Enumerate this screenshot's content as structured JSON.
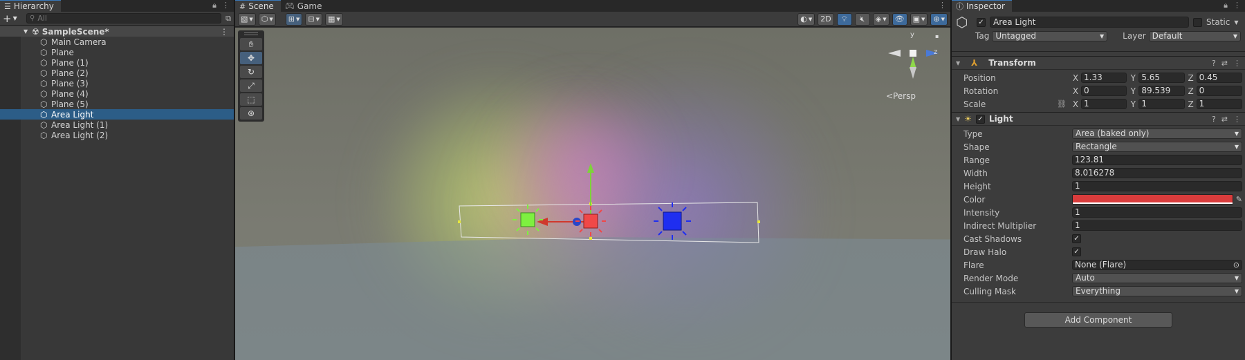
{
  "hierarchy": {
    "tab_label": "Hierarchy",
    "search_placeholder": "All",
    "scene_name": "SampleScene*",
    "items": [
      {
        "label": "Main Camera"
      },
      {
        "label": "Plane"
      },
      {
        "label": "Plane (1)"
      },
      {
        "label": "Plane (2)"
      },
      {
        "label": "Plane (3)"
      },
      {
        "label": "Plane (4)"
      },
      {
        "label": "Plane (5)"
      },
      {
        "label": "Area Light",
        "selected": true
      },
      {
        "label": "Area Light (1)"
      },
      {
        "label": "Area Light (2)"
      }
    ]
  },
  "scene": {
    "tabs": [
      {
        "label": "Scene"
      },
      {
        "label": "Game"
      }
    ],
    "toolbar_2d": "2D",
    "persp_label": "<Persp",
    "gizmo_axes": {
      "y": "y",
      "z": "z"
    }
  },
  "inspector": {
    "tab_label": "Inspector",
    "object_name": "Area Light",
    "static_label": "Static",
    "tag_label": "Tag",
    "tag_value": "Untagged",
    "layer_label": "Layer",
    "layer_value": "Default",
    "transform": {
      "title": "Transform",
      "position": {
        "label": "Position",
        "x": "1.33",
        "y": "5.65",
        "z": "0.45"
      },
      "rotation": {
        "label": "Rotation",
        "x": "0",
        "y": "89.539",
        "z": "0"
      },
      "scale": {
        "label": "Scale",
        "x": "1",
        "y": "1",
        "z": "1"
      }
    },
    "light": {
      "title": "Light",
      "type": {
        "label": "Type",
        "value": "Area (baked only)"
      },
      "shape": {
        "label": "Shape",
        "value": "Rectangle"
      },
      "range": {
        "label": "Range",
        "value": "123.81"
      },
      "width": {
        "label": "Width",
        "value": "8.016278"
      },
      "height": {
        "label": "Height",
        "value": "1"
      },
      "color": {
        "label": "Color",
        "value": "#D93C3C"
      },
      "intensity": {
        "label": "Intensity",
        "value": "1"
      },
      "indirect": {
        "label": "Indirect Multiplier",
        "value": "1"
      },
      "cast_shadows": {
        "label": "Cast Shadows",
        "checked": true
      },
      "draw_halo": {
        "label": "Draw Halo",
        "checked": true
      },
      "flare": {
        "label": "Flare",
        "value": "None (Flare)"
      },
      "render_mode": {
        "label": "Render Mode",
        "value": "Auto"
      },
      "culling_mask": {
        "label": "Culling Mask",
        "value": "Everything"
      }
    },
    "add_component_label": "Add Component"
  },
  "colors": {
    "selection": "#2C5D87",
    "accent_blue": "#3A79BB",
    "light_color": "#D93C3C"
  }
}
